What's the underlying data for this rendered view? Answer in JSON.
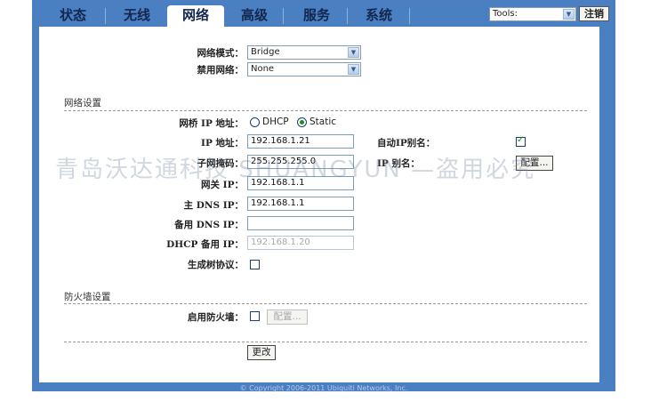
{
  "nav": {
    "tabs": [
      {
        "label": "状态"
      },
      {
        "label": "无线"
      },
      {
        "label": "网络"
      },
      {
        "label": "高级"
      },
      {
        "label": "服务"
      },
      {
        "label": "系统"
      }
    ],
    "active_tab": "网络",
    "tools_select": "Tools:",
    "logout_label": "注销"
  },
  "top": {
    "network_mode_label": "网络模式：",
    "network_mode_value": "Bridge",
    "disable_network_label": "禁用网络：",
    "disable_network_value": "None"
  },
  "network_settings": {
    "section_title": "网络设置",
    "bridge_ip_label": "网桥 IP 地址：",
    "radio_dhcp": "DHCP",
    "radio_static": "Static",
    "static_selected": true,
    "ip_label": "IP 地址：",
    "ip_value": "192.168.1.21",
    "netmask_label": "子网掩码：",
    "netmask_value": "255.255.255.0",
    "gateway_label": "网关 IP：",
    "gateway_value": "192.168.1.1",
    "dns1_label": "主 DNS IP：",
    "dns1_value": "192.168.1.1",
    "dns2_label": "备用 DNS IP：",
    "dns2_value": "",
    "dhcp_fallback_label": "DHCP 备用 IP：",
    "dhcp_fallback_value": "192.168.1.20",
    "stp_label": "生成树协议：",
    "stp_checked": false,
    "auto_ip_alias_label": "自动IP别名：",
    "auto_ip_alias_checked": true,
    "ip_alias_label": "IP 别名：",
    "ip_alias_button": "配置..."
  },
  "firewall": {
    "section_title": "防火墙设置",
    "enable_label": "启用防火墙：",
    "enable_checked": false,
    "config_button": "配置..."
  },
  "actions": {
    "change_button": "更改"
  },
  "watermark": "青岛沃达通科技 SHUANGYUN —盗用必究",
  "footer": {
    "copyright": "© Copyright 2006-2011 Ubiquiti Networks, Inc."
  },
  "colors": {
    "frame_blue": "#4a7fc1",
    "tab_text": "#13264d",
    "check_green": "#1c8a1c"
  }
}
